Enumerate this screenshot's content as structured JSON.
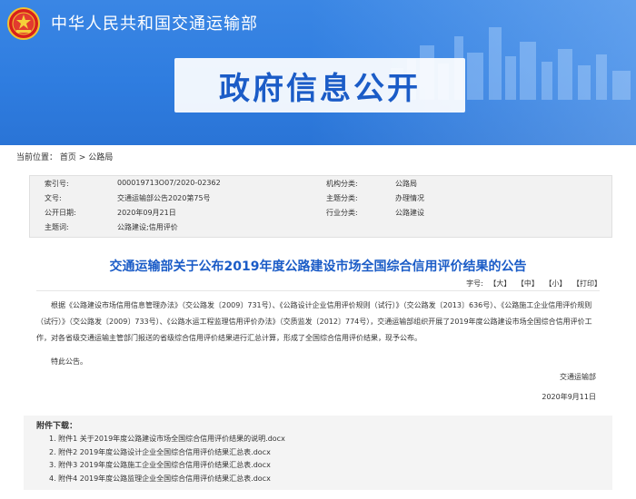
{
  "header": {
    "site_name": "中华人民共和国交通运输部",
    "banner_title": "政府信息公开",
    "brand_color": "#2f7de0"
  },
  "breadcrumb": {
    "prefix": "当前位置：",
    "items": [
      "首页",
      "公路局"
    ],
    "separator": ">"
  },
  "meta": {
    "index_label": "索引号:",
    "index_value": "000019713O07/2020-02362",
    "org_label": "机构分类:",
    "org_value": "公路局",
    "doc_label": "文号:",
    "doc_value": "交通运输部公告2020第75号",
    "topic_label": "主题分类:",
    "topic_value": "办理情况",
    "date_label": "公开日期:",
    "date_value": "2020年09月21日",
    "industry_label": "行业分类:",
    "industry_value": "公路建设",
    "keyword_label": "主题词:",
    "keyword_value": "公路建设;信用评价"
  },
  "article": {
    "title": "交通运输部关于公布2019年度公路建设市场全国综合信用评价结果的公告",
    "font_label": "字号:",
    "font_large": "【大】",
    "font_medium": "【中】",
    "font_small": "【小】",
    "print": "【打印】",
    "para1": "根据《公路建设市场信用信息管理办法》（交公路发〔2009〕731号）、《公路设计企业信用评价规则（试行）》（交公路发〔2013〕636号）、《公路施工企业信用评价规则（试行）》（交公路发〔2009〕733号）、《公路水运工程监理信用评价办法》（交质监发〔2012〕774号），交通运输部组织开展了2019年度公路建设市场全国综合信用评价工作，对各省级交通运输主管部门报送的省级综合信用评价结果进行汇总计算，形成了全国综合信用评价结果，现予公布。",
    "para2": "特此公告。",
    "signer": "交通运输部",
    "sign_date": "2020年9月11日"
  },
  "attachments": {
    "title": "附件下载：",
    "items": [
      "1.  附件1 关于2019年度公路建设市场全国综合信用评价结果的说明.docx",
      "2.  附件2 2019年度公路设计企业全国综合信用评价结果汇总表.docx",
      "3.  附件3 2019年度公路施工企业全国综合信用评价结果汇总表.docx",
      "4.  附件4 2019年度公路监理企业全国综合信用评价结果汇总表.docx"
    ]
  }
}
